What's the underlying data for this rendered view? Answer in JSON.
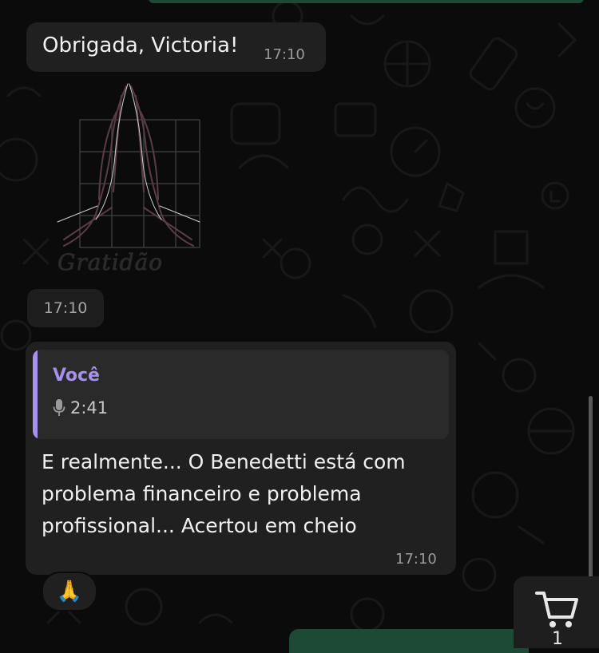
{
  "messages": [
    {
      "text": "Obrigada, Victoria!",
      "time": "17:10"
    },
    {
      "type": "sticker",
      "caption": "Gratidão",
      "time": "17:10"
    },
    {
      "quote": {
        "author": "Você",
        "audio_duration": "2:41"
      },
      "text": "E realmente... O Benedetti está com\nproblema financeiro e problema\nprofissional... Acertou em cheio",
      "time": "17:10",
      "reaction": "🙏"
    }
  ],
  "cart": {
    "count": "1"
  },
  "colors": {
    "background": "#0b0b0b",
    "bubble": "#202020",
    "quote_accent": "#a791ef",
    "outgoing_bubble": "#1d4a37"
  },
  "icons": {
    "microphone": "microphone-icon",
    "cart": "cart-icon"
  }
}
